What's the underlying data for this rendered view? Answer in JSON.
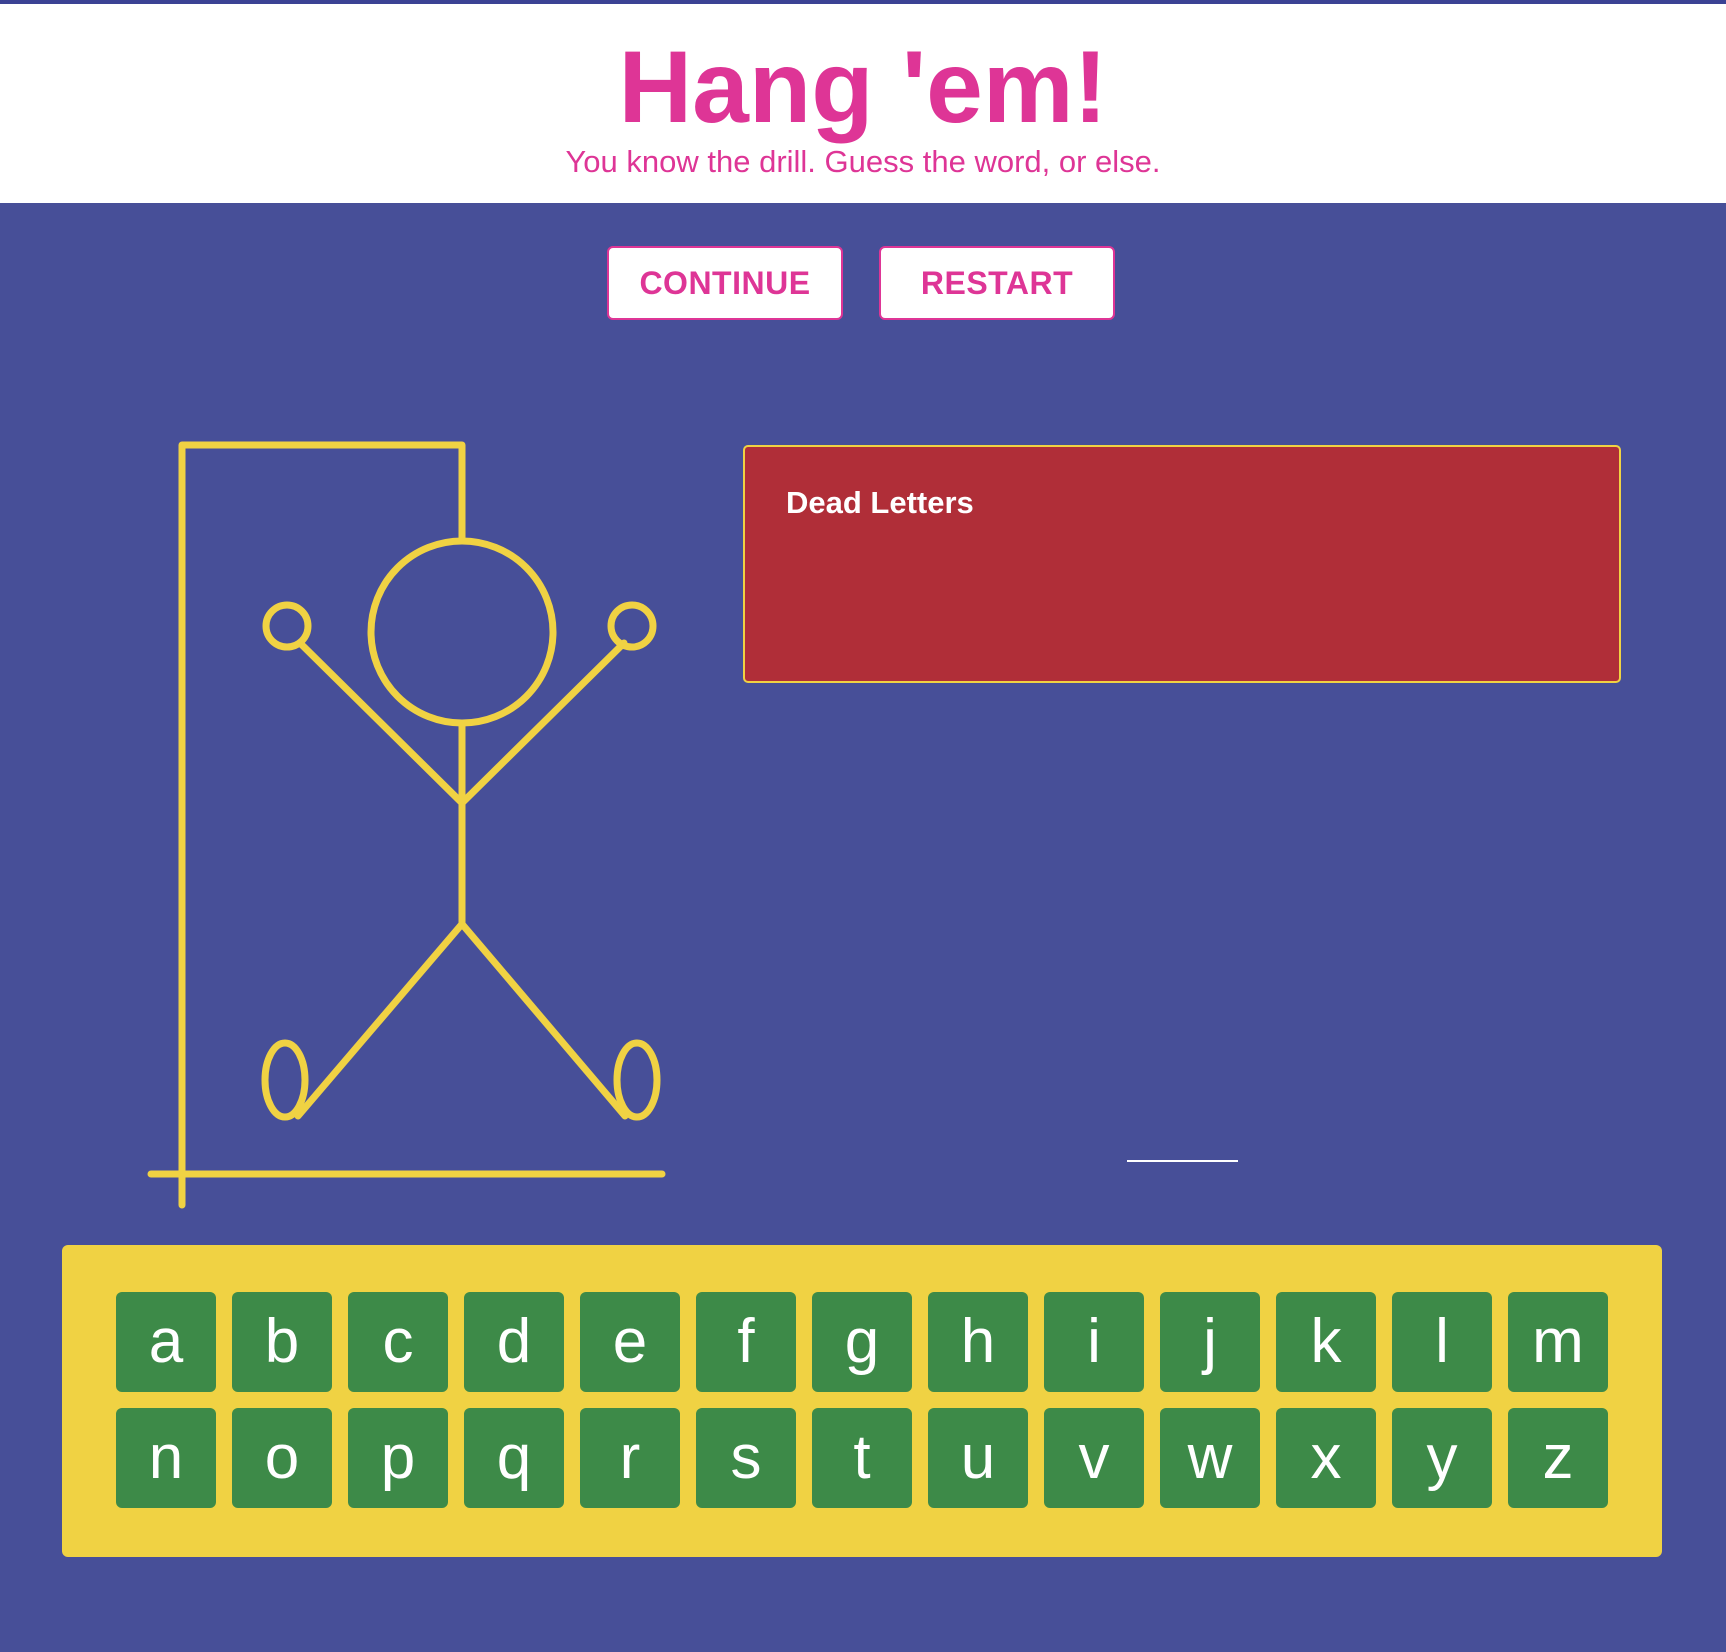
{
  "header": {
    "title": "Hang 'em!",
    "subtitle": "You know the drill. Guess the word, or else."
  },
  "controls": {
    "continue_label": "CONTINUE",
    "restart_label": "RESTART"
  },
  "dead_letters": {
    "title": "Dead Letters",
    "letters": ""
  },
  "word": {
    "blank_count": 1
  },
  "keyboard": {
    "keys": [
      "a",
      "b",
      "c",
      "d",
      "e",
      "f",
      "g",
      "h",
      "i",
      "j",
      "k",
      "l",
      "m",
      "n",
      "o",
      "p",
      "q",
      "r",
      "s",
      "t",
      "u",
      "v",
      "w",
      "x",
      "y",
      "z"
    ]
  },
  "colors": {
    "background": "#474f98",
    "accent_pink": "#de3596",
    "gallows_yellow": "#f0d243",
    "dead_letters_red": "#b02e38",
    "key_green": "#3d8a48",
    "header_white": "#ffffff"
  }
}
